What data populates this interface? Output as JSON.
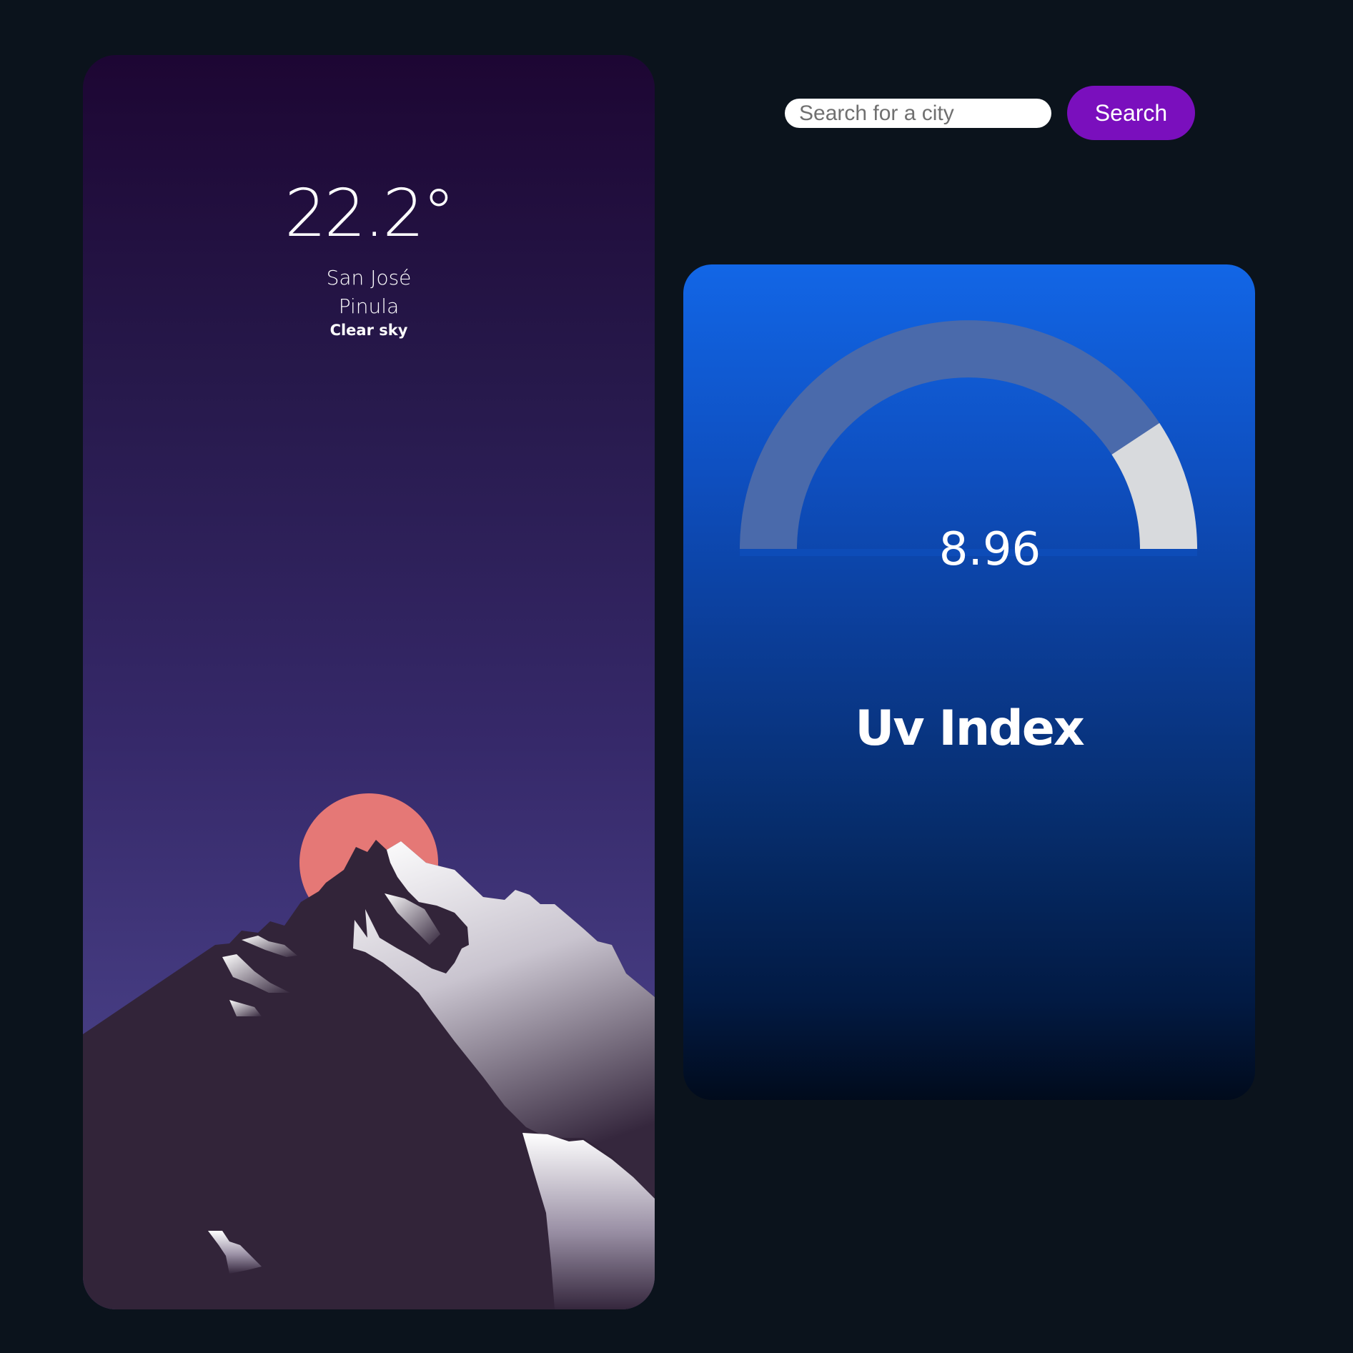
{
  "weather": {
    "temperature": "22.2°",
    "city_line1": "San José",
    "city_line2": "Pinula",
    "description": "Clear sky"
  },
  "search": {
    "placeholder": "Search for a city",
    "value": "",
    "button_label": "Search"
  },
  "uv": {
    "value": "8.96",
    "value_number": 8.96,
    "max": 11,
    "label": "Uv Index"
  },
  "colors": {
    "page_background": "#0b131c",
    "search_button": "#7a0fbd",
    "sun": "#e57876",
    "gauge_track": "#4a6aab",
    "gauge_fill": "#d8dadd"
  }
}
